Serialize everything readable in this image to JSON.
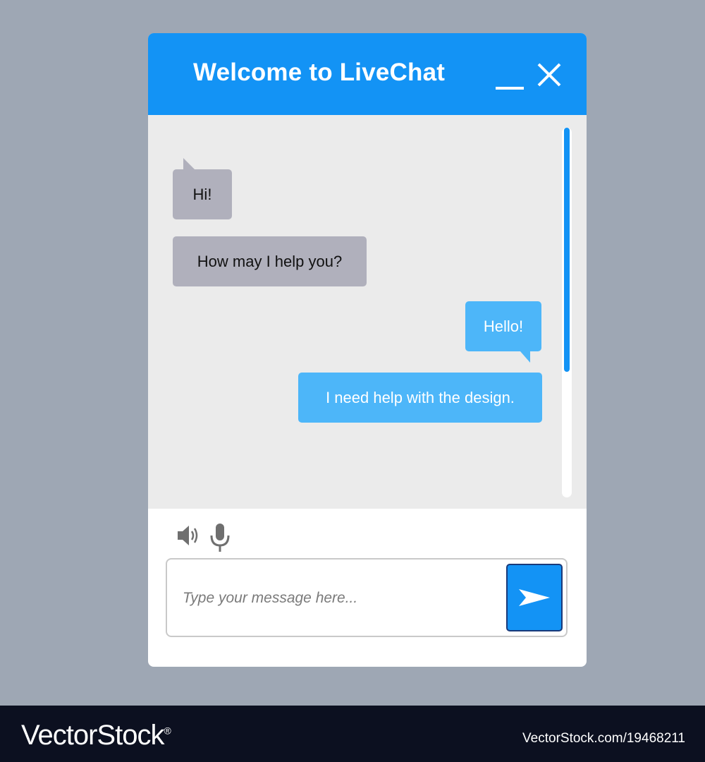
{
  "header": {
    "title": "Welcome to LiveChat",
    "minimize_icon": "minimize-icon",
    "close_icon": "close-icon",
    "color": "#1393f5"
  },
  "messages": [
    {
      "sender": "agent",
      "text": "Hi!"
    },
    {
      "sender": "agent",
      "text": "How may I help you?"
    },
    {
      "sender": "user",
      "text": "Hello!"
    },
    {
      "sender": "user",
      "text": "I need help with the design."
    }
  ],
  "colors": {
    "agent_bubble": "#b0b0bc",
    "user_bubble": "#4db6f9",
    "scrollbar": "#1393f5"
  },
  "toolbar": {
    "speaker_icon": "speaker-icon",
    "microphone_icon": "microphone-icon"
  },
  "composer": {
    "placeholder": "Type your message here...",
    "value": "",
    "send_icon": "send-icon"
  },
  "watermark": {
    "brand": "VectorStock",
    "registered_mark": "®",
    "id": "VectorStock.com/19468211"
  }
}
